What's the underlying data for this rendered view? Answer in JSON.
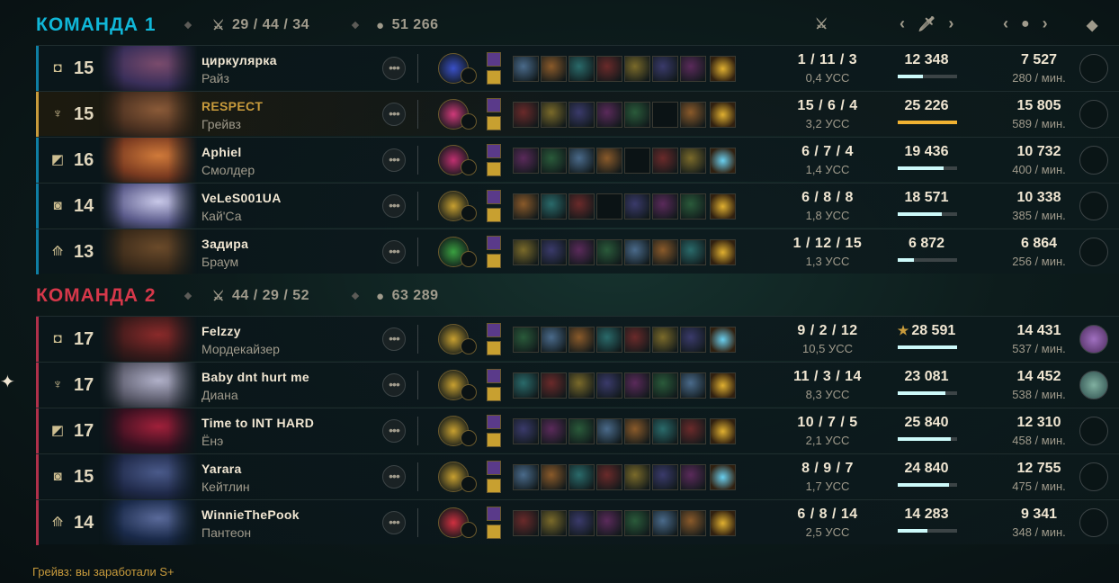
{
  "teams": [
    {
      "title": "КОМАНДА 1",
      "kda": "29 / 44 / 34",
      "gold": "51 266",
      "players": [
        {
          "role_icon": "top-role-icon",
          "level": "15",
          "name": "циркулярка",
          "champion": "Райз",
          "kda": "1 / 11 / 3",
          "cs_score": "0,4 УСС",
          "damage": "12 348",
          "damage_fraction": 0.43,
          "gold": "7 527",
          "gold_rate": "280 / мин.",
          "highlight": false
        },
        {
          "role_icon": "jungle-role-icon",
          "level": "15",
          "name": "RESPECT",
          "champion": "Грейвз",
          "kda": "15 / 6 / 4",
          "cs_score": "3,2 УСС",
          "damage": "25 226",
          "damage_fraction": 1.0,
          "gold": "15 805",
          "gold_rate": "589 / мин.",
          "highlight": true
        },
        {
          "role_icon": "mid-role-icon",
          "level": "16",
          "name": "Aphiel",
          "champion": "Смолдер",
          "kda": "6 / 7 / 4",
          "cs_score": "1,4 УСС",
          "damage": "19 436",
          "damage_fraction": 0.77,
          "gold": "10 732",
          "gold_rate": "400 / мин.",
          "highlight": false
        },
        {
          "role_icon": "bottom-role-icon",
          "level": "14",
          "name": "VeLeS001UA",
          "champion": "Кай'Са",
          "kda": "6 / 8 / 8",
          "cs_score": "1,8 УСС",
          "damage": "18 571",
          "damage_fraction": 0.74,
          "gold": "10 338",
          "gold_rate": "385 / мин.",
          "highlight": false
        },
        {
          "role_icon": "support-role-icon",
          "level": "13",
          "name": "Задира",
          "champion": "Браум",
          "kda": "1 / 12 / 15",
          "cs_score": "1,3 УСС",
          "damage": "6 872",
          "damage_fraction": 0.27,
          "gold": "6 864",
          "gold_rate": "256 / мин.",
          "highlight": false
        }
      ]
    },
    {
      "title": "КОМАНДА 2",
      "kda": "44 / 29 / 52",
      "gold": "63 289",
      "players": [
        {
          "role_icon": "top-role-icon",
          "level": "17",
          "name": "Felzzy",
          "champion": "Мордекайзер",
          "kda": "9 / 2 / 12",
          "cs_score": "10,5 УСС",
          "damage": "28 591",
          "damage_prefix": "★",
          "damage_fraction": 1.0,
          "gold": "14 431",
          "gold_rate": "537 / мин.",
          "highlight": false
        },
        {
          "role_icon": "jungle-role-icon",
          "level": "17",
          "name": "Baby dnt hurt me",
          "champion": "Диана",
          "kda": "11 / 3 / 14",
          "cs_score": "8,3 УСС",
          "damage": "23 081",
          "damage_fraction": 0.81,
          "gold": "14 452",
          "gold_rate": "538 / мин.",
          "highlight": false
        },
        {
          "role_icon": "mid-role-icon",
          "level": "17",
          "name": "Time to INT HARD",
          "champion": "Ёнэ",
          "kda": "10 / 7 / 5",
          "cs_score": "2,1 УСС",
          "damage": "25 840",
          "damage_fraction": 0.9,
          "gold": "12 310",
          "gold_rate": "458 / мин.",
          "highlight": false
        },
        {
          "role_icon": "bottom-role-icon",
          "level": "15",
          "name": "Yarara",
          "champion": "Кейтлин",
          "kda": "8 / 9 / 7",
          "cs_score": "1,7 УСС",
          "damage": "24 840",
          "damage_fraction": 0.87,
          "gold": "12 755",
          "gold_rate": "475 / мин.",
          "highlight": false
        },
        {
          "role_icon": "support-role-icon",
          "level": "14",
          "name": "WinnieThePook",
          "champion": "Пантеон",
          "kda": "6 / 8 / 14",
          "cs_score": "2,5 УСС",
          "damage": "14 283",
          "damage_fraction": 0.5,
          "gold": "9 341",
          "gold_rate": "348 / мин.",
          "highlight": false
        }
      ]
    }
  ],
  "footer_message": "Грейвз: вы заработали S+",
  "colors": {
    "team1": "#10b7d8",
    "team2": "#d6384a",
    "gold_accent": "#c89b3c",
    "damage_bar": "#cdfafa",
    "damage_bar_highlight": "#f0b232"
  }
}
